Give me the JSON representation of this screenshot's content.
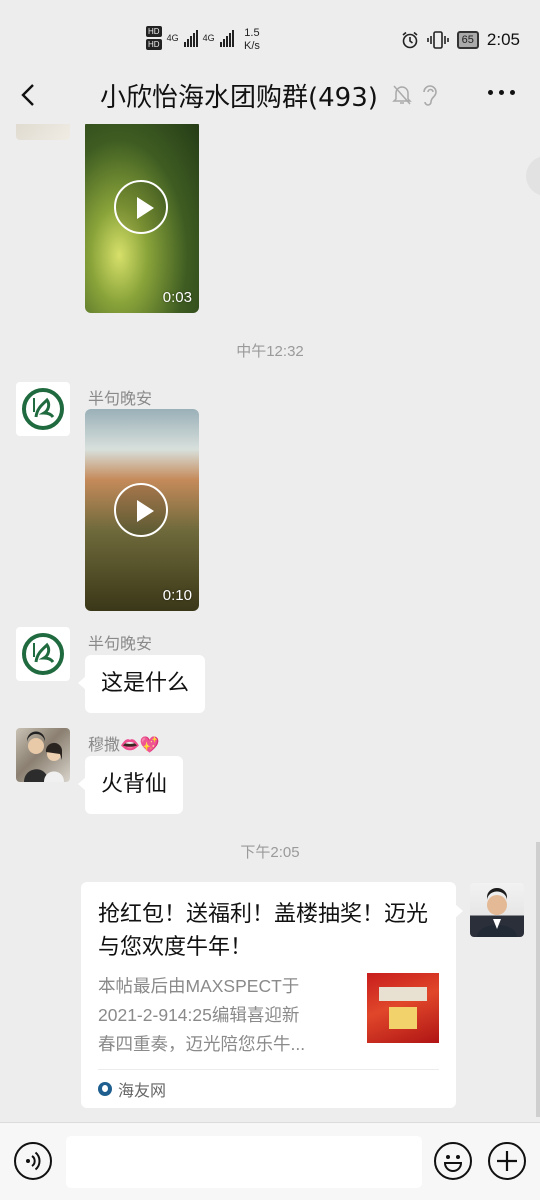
{
  "status_bar": {
    "hd_badges": [
      "HD",
      "HD"
    ],
    "network_labels": [
      "4G",
      "4G"
    ],
    "speed_value": "1.5",
    "speed_unit": "K/s",
    "battery": "65",
    "time": "2:05"
  },
  "header": {
    "title": "小欣怡海水团购群(493)",
    "back_icon": "chevron-left-icon",
    "mute_icon": "bell-off-icon",
    "ear_icon": "ear-icon",
    "more_icon": "more-dots-icon"
  },
  "messages": {
    "video1_duration": "0:03",
    "time1": "中午12:32",
    "sender1": "半句晚安",
    "video2_duration": "0:10",
    "sender2": "半句晚安",
    "text1": "这是什么",
    "sender3": "穆撒👄💖",
    "text2": "火背仙",
    "time2": "下午2:05"
  },
  "card": {
    "title": "抢红包！送福利！盖楼抽奖！迈光与您欢度牛年！",
    "desc_lines": [
      "本帖最后由MAXSPECT于",
      "2021-2-914:25编辑喜迎新",
      "春四重奏，迈光陪您乐牛..."
    ],
    "source": "海友网"
  },
  "input_bar": {
    "voice_icon": "voice-icon",
    "emoji_icon": "emoji-icon",
    "add_icon": "plus-icon"
  },
  "colors": {
    "background": "#ededed",
    "bubble": "#ffffff",
    "meta_text": "#9a9a9a"
  }
}
